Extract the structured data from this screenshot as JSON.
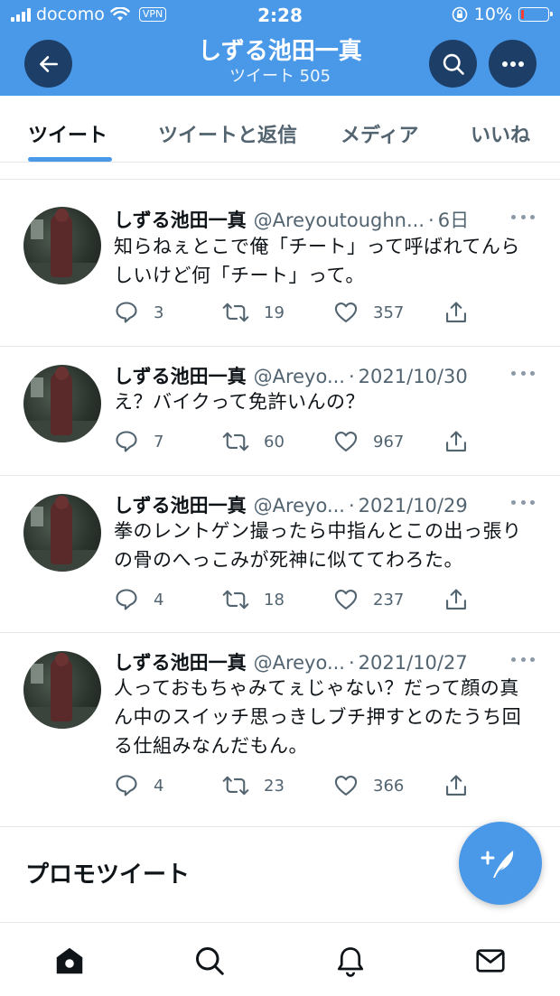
{
  "status_bar": {
    "carrier": "docomo",
    "vpn_label": "VPN",
    "time": "2:28",
    "battery_percent": "10%",
    "battery_level": 0.1,
    "battery_color": "#ff3b30"
  },
  "profile_header": {
    "name": "しずる池田一真",
    "tweet_count": "ツイート 505",
    "background_color": "#4a99e9"
  },
  "tabs": [
    {
      "label": "ツイート",
      "active": true
    },
    {
      "label": "ツイートと返信",
      "active": false
    },
    {
      "label": "メディア",
      "active": false
    },
    {
      "label": "いいね",
      "active": false
    }
  ],
  "tweets": [
    {
      "name": "しずる池田一真",
      "handle": "@Areyoutoughn...",
      "date": "6日",
      "text": "知らねぇとこで俺「チート」って呼ばれてんらしいけど何「チート」って。",
      "replies": "3",
      "retweets": "19",
      "likes": "357"
    },
    {
      "name": "しずる池田一真",
      "handle": "@Areyo...",
      "date": "2021/10/30",
      "text": "え？バイクって免許いんの？",
      "replies": "7",
      "retweets": "60",
      "likes": "967"
    },
    {
      "name": "しずる池田一真",
      "handle": "@Areyo...",
      "date": "2021/10/29",
      "text": "拳のレントゲン撮ったら中指んとこの出っ張りの骨のへっこみが死神に似ててわろた。",
      "replies": "4",
      "retweets": "18",
      "likes": "237"
    },
    {
      "name": "しずる池田一真",
      "handle": "@Areyo...",
      "date": "2021/10/27",
      "text": "人っておもちゃみてぇじゃない？だって顔の真ん中のスイッチ思っきしブチ押すとのたうち回る仕組みなんだもん。",
      "replies": "4",
      "retweets": "23",
      "likes": "366"
    }
  ],
  "promo": {
    "title": "プロモツイート"
  },
  "icons": {
    "back": "arrow-left-icon",
    "search": "search-icon",
    "more": "more-horizontal-icon",
    "compose": "compose-tweet-icon",
    "nav": [
      "home-icon",
      "search-icon",
      "notifications-icon",
      "messages-icon"
    ]
  },
  "colors": {
    "accent": "#4a99e9",
    "header_button": "#1d3f67",
    "secondary_text": "#536471"
  }
}
